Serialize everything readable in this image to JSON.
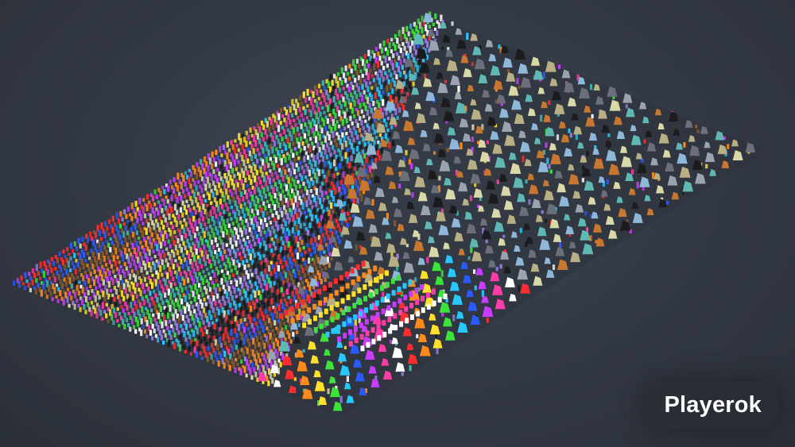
{
  "watermark": {
    "text": "Playerok"
  },
  "scene": {
    "description_icon": "isometric-item-grid",
    "colors": {
      "background": "#353b46",
      "item_palette": [
        "#ff2d2d",
        "#ff8a1c",
        "#ffe02a",
        "#3be33b",
        "#27c8ff",
        "#2a5bff",
        "#c83cff",
        "#ff3ca8",
        "#ffffff",
        "#1a1a1a",
        "#8a5a2b",
        "#d8d8a8",
        "#3fb7b2",
        "#9c7de8"
      ]
    }
  }
}
